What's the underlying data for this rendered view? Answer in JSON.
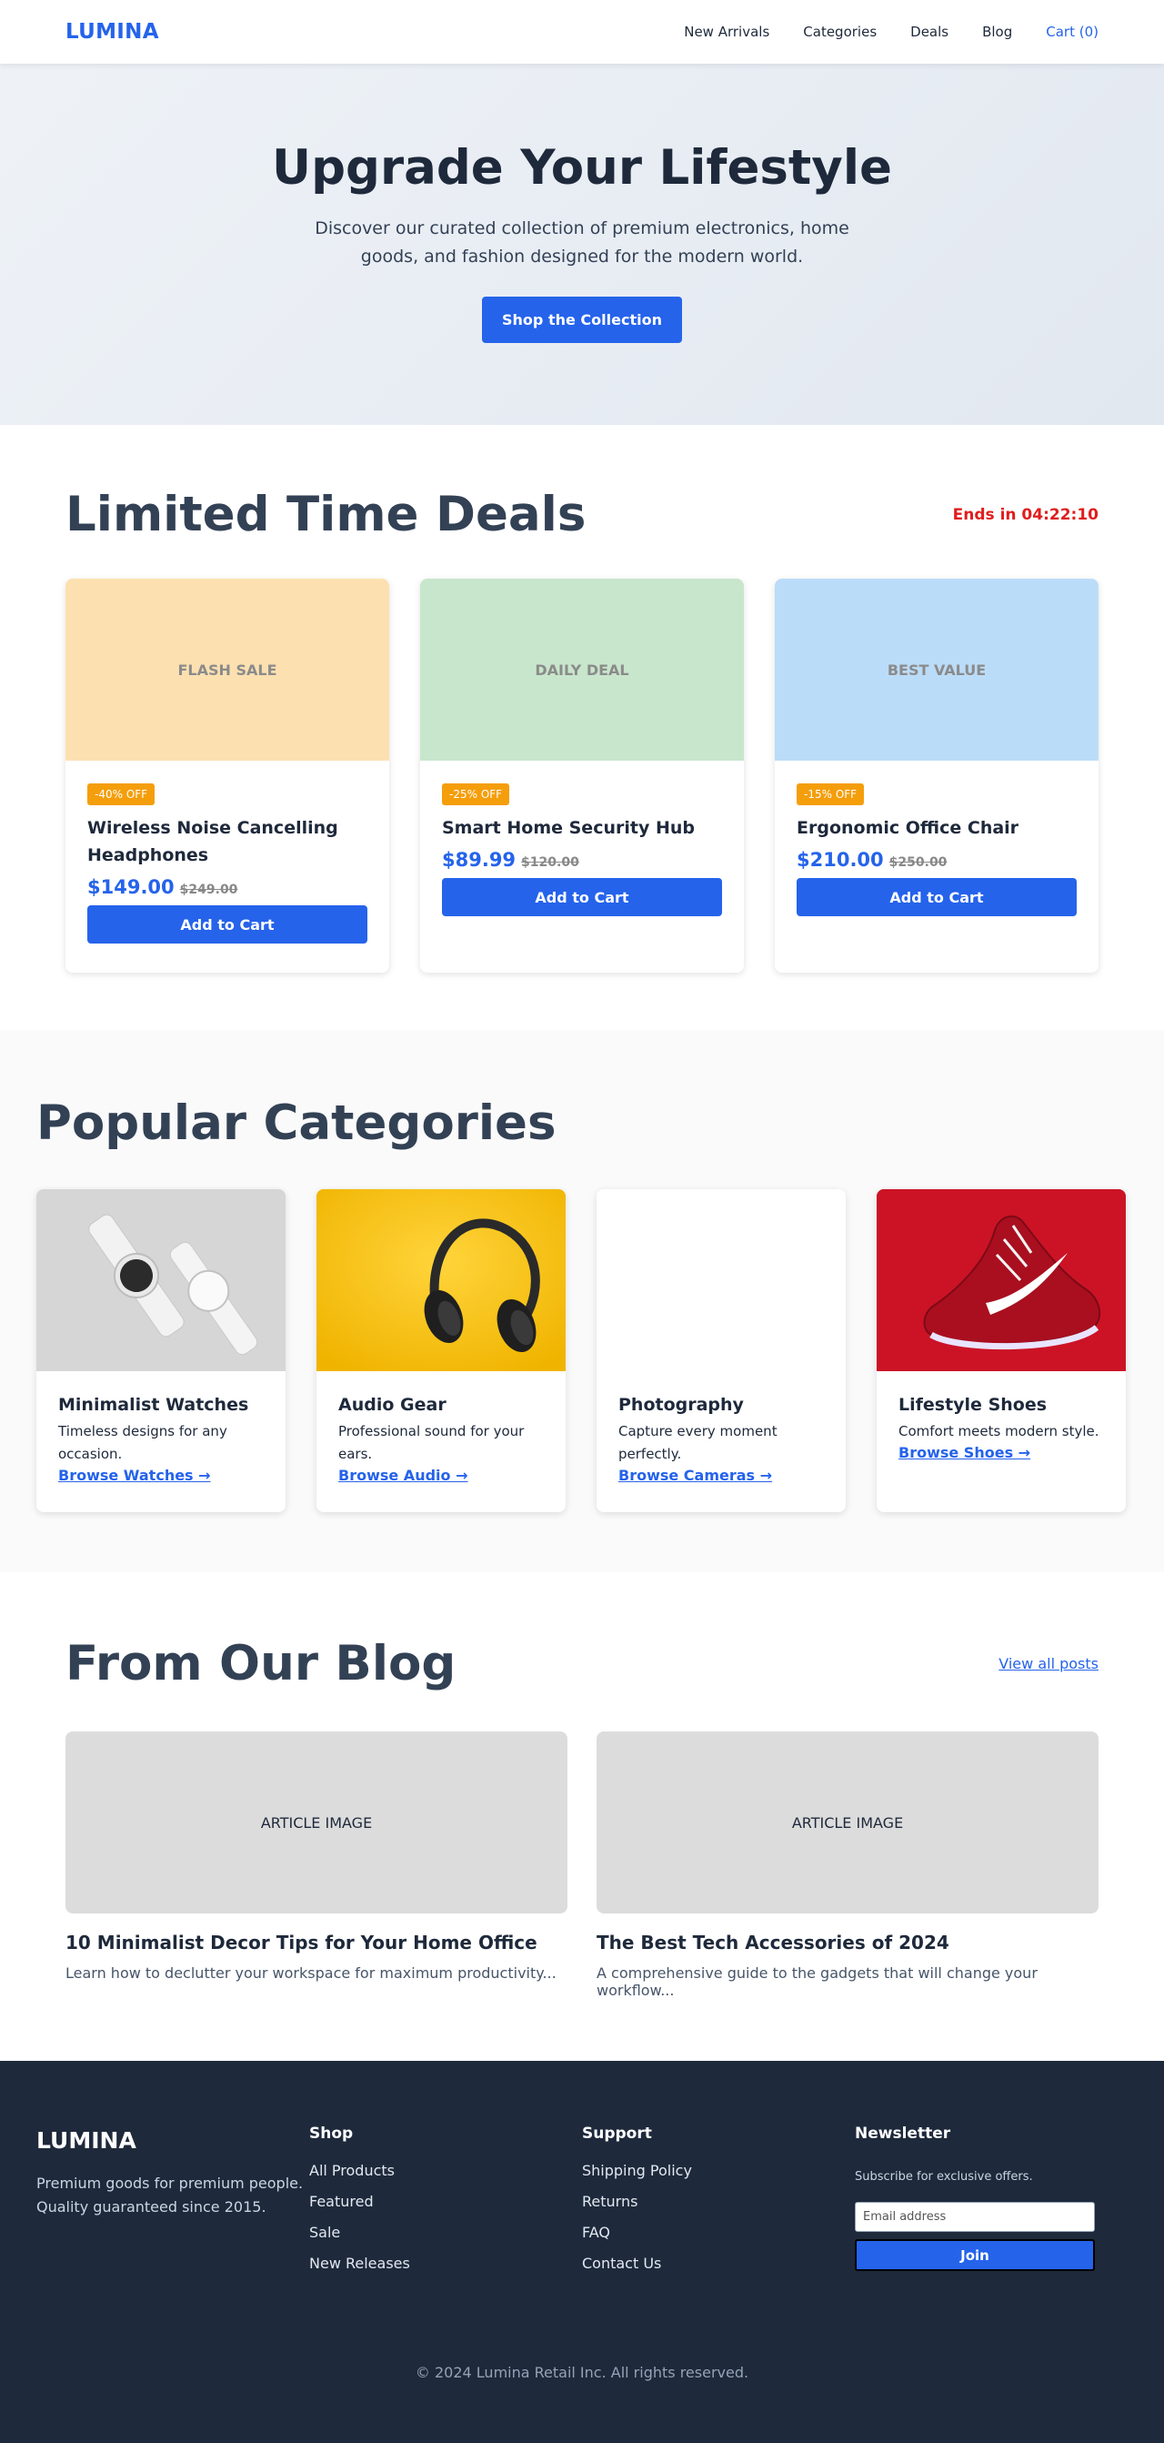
{
  "nav": {
    "logo": "LUMINA",
    "links": [
      "New Arrivals",
      "Categories",
      "Deals",
      "Blog"
    ],
    "cart": "Cart (0)"
  },
  "hero": {
    "title": "Upgrade Your Lifestyle",
    "subtitle": "Discover our curated collection of premium electronics, home goods, and fashion designed for the modern world.",
    "cta": "Shop the Collection"
  },
  "deals": {
    "title": "Limited Time Deals",
    "timer": "Ends in 04:22:10",
    "items": [
      {
        "image_label": "FLASH SALE",
        "image_color": "#fde0b0",
        "badge": "-40% OFF",
        "name": "Wireless Noise Cancelling Headphones",
        "price": "$149.00",
        "old_price": "$249.00",
        "button": "Add to Cart"
      },
      {
        "image_label": "DAILY DEAL",
        "image_color": "#c8e6cb",
        "badge": "-25% OFF",
        "name": "Smart Home Security Hub",
        "price": "$89.99",
        "old_price": "$120.00",
        "button": "Add to Cart"
      },
      {
        "image_label": "BEST VALUE",
        "image_color": "#bbdcf8",
        "badge": "-15% OFF",
        "name": "Ergonomic Office Chair",
        "price": "$210.00",
        "old_price": "$250.00",
        "button": "Add to Cart"
      }
    ]
  },
  "categories": {
    "title": "Popular Categories",
    "items": [
      {
        "name": "Minimalist Watches",
        "desc": "Timeless designs for any occasion.",
        "link": "Browse Watches →"
      },
      {
        "name": "Audio Gear",
        "desc": "Professional sound for your ears.",
        "link": "Browse Audio →"
      },
      {
        "name": "Photography",
        "desc": "Capture every moment perfectly.",
        "link": "Browse Cameras →"
      },
      {
        "name": "Lifestyle Shoes",
        "desc": "Comfort meets modern style.",
        "link": "Browse Shoes →"
      }
    ]
  },
  "blog": {
    "title": "From Our Blog",
    "view_all": "View all posts",
    "posts": [
      {
        "image_label": "ARTICLE IMAGE",
        "title": "10 Minimalist Decor Tips for Your Home Office",
        "excerpt": "Learn how to declutter your workspace for maximum productivity..."
      },
      {
        "image_label": "ARTICLE IMAGE",
        "title": "The Best Tech Accessories of 2024",
        "excerpt": "A comprehensive guide to the gadgets that will change your workflow..."
      }
    ]
  },
  "footer": {
    "logo": "LUMINA",
    "about": "Premium goods for premium people. Quality guaranteed since 2015.",
    "shop": {
      "heading": "Shop",
      "links": [
        "All Products",
        "Featured",
        "Sale",
        "New Releases"
      ]
    },
    "support": {
      "heading": "Support",
      "links": [
        "Shipping Policy",
        "Returns",
        "FAQ",
        "Contact Us"
      ]
    },
    "newsletter": {
      "heading": "Newsletter",
      "text": "Subscribe for exclusive offers.",
      "placeholder": "Email address",
      "button": "Join"
    },
    "copyright": "© 2024 Lumina Retail Inc. All rights reserved."
  }
}
